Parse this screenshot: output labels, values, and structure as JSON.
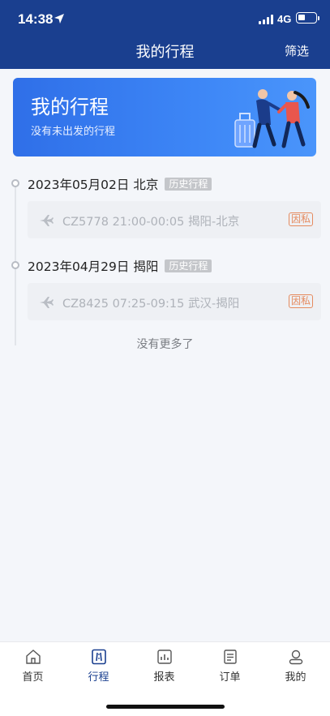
{
  "status_bar": {
    "time": "14:38",
    "network": "4G"
  },
  "header": {
    "title": "我的行程",
    "filter_label": "筛选"
  },
  "banner": {
    "title": "我的行程",
    "subtitle": "没有未出发的行程"
  },
  "trips": [
    {
      "date": "2023年05月02日 北京",
      "tag": "历史行程",
      "detail": "CZ5778 21:00-00:05 揭阳-北京",
      "reason": "因私"
    },
    {
      "date": "2023年04月29日 揭阳",
      "tag": "历史行程",
      "detail": "CZ8425 07:25-09:15 武汉-揭阳",
      "reason": "因私"
    }
  ],
  "list_end_text": "没有更多了",
  "tabbar": {
    "items": [
      {
        "label": "首页",
        "icon": "home-icon"
      },
      {
        "label": "行程",
        "icon": "trip-icon",
        "active": true
      },
      {
        "label": "报表",
        "icon": "report-icon"
      },
      {
        "label": "订单",
        "icon": "order-icon"
      },
      {
        "label": "我的",
        "icon": "profile-icon"
      }
    ]
  },
  "colors": {
    "header": "#1a3f8f",
    "banner": "#3d86f6",
    "reason": "#e58a5e",
    "active_tab": "#1a3f8f"
  }
}
